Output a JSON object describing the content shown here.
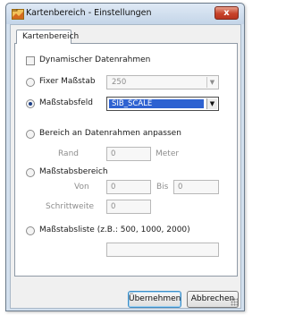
{
  "window": {
    "title": "Kartenbereich - Einstellungen",
    "close_glyph": "x"
  },
  "tabs": [
    {
      "label": "Kartenbereich",
      "selected": true
    }
  ],
  "options": {
    "dynamic_frame": {
      "label": "Dynamischer Datenrahmen",
      "checked": false
    },
    "fixed_scale": {
      "label": "Fixer Maßstab",
      "value": "250",
      "selected": false
    },
    "scale_field": {
      "label": "Maßstabsfeld",
      "value": "SIB_SCALE",
      "selected": true
    },
    "fit_to_frame": {
      "label": "Bereich an Datenrahmen anpassen",
      "selected": false,
      "margin_label": "Rand",
      "margin_value": "0",
      "margin_unit": "Meter"
    },
    "scale_range": {
      "label": "Maßstabsbereich",
      "selected": false,
      "from_label": "Von",
      "from_value": "0",
      "to_label": "Bis",
      "to_value": "0",
      "step_label": "Schrittweite",
      "step_value": "0"
    },
    "scale_list": {
      "label": "Maßstabsliste (z.B.: 500, 1000, 2000)",
      "selected": false,
      "value": ""
    }
  },
  "buttons": {
    "ok": "Übernehmen",
    "cancel": "Abbrechen"
  },
  "colors": {
    "selection": "#2e62d1",
    "close": "#c7432b",
    "frame": "#d3e0ee"
  },
  "icons": {
    "title": "map-app-icon",
    "close": "close-icon",
    "dropdown": "chevron-down-icon"
  }
}
